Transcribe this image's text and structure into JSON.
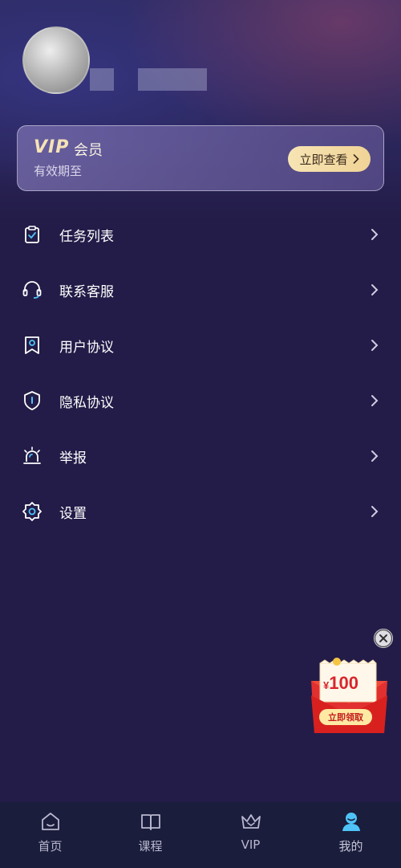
{
  "vip_card": {
    "logo": "VIP",
    "title": "会员",
    "subtitle": "有效期至",
    "button_label": "立即查看"
  },
  "menu": {
    "items": [
      {
        "label": "任务列表",
        "icon": "clipboard-check-icon"
      },
      {
        "label": "联系客服",
        "icon": "headset-icon"
      },
      {
        "label": "用户协议",
        "icon": "bookmark-icon"
      },
      {
        "label": "隐私协议",
        "icon": "shield-icon"
      },
      {
        "label": "举报",
        "icon": "alarm-light-icon"
      },
      {
        "label": "设置",
        "icon": "gear-icon"
      }
    ]
  },
  "promo": {
    "currency": "¥",
    "amount": "100",
    "button_label": "立即领取"
  },
  "tabbar": {
    "items": [
      {
        "label": "首页",
        "icon": "home-icon"
      },
      {
        "label": "课程",
        "icon": "book-icon"
      },
      {
        "label": "VIP",
        "icon": "crown-icon"
      },
      {
        "label": "我的",
        "icon": "user-icon",
        "active": true
      }
    ]
  },
  "colors": {
    "background": "#231c48",
    "vip_accent": "#f0d396",
    "promo_red": "#d9262c",
    "active_tab": "#4fc3f7"
  }
}
